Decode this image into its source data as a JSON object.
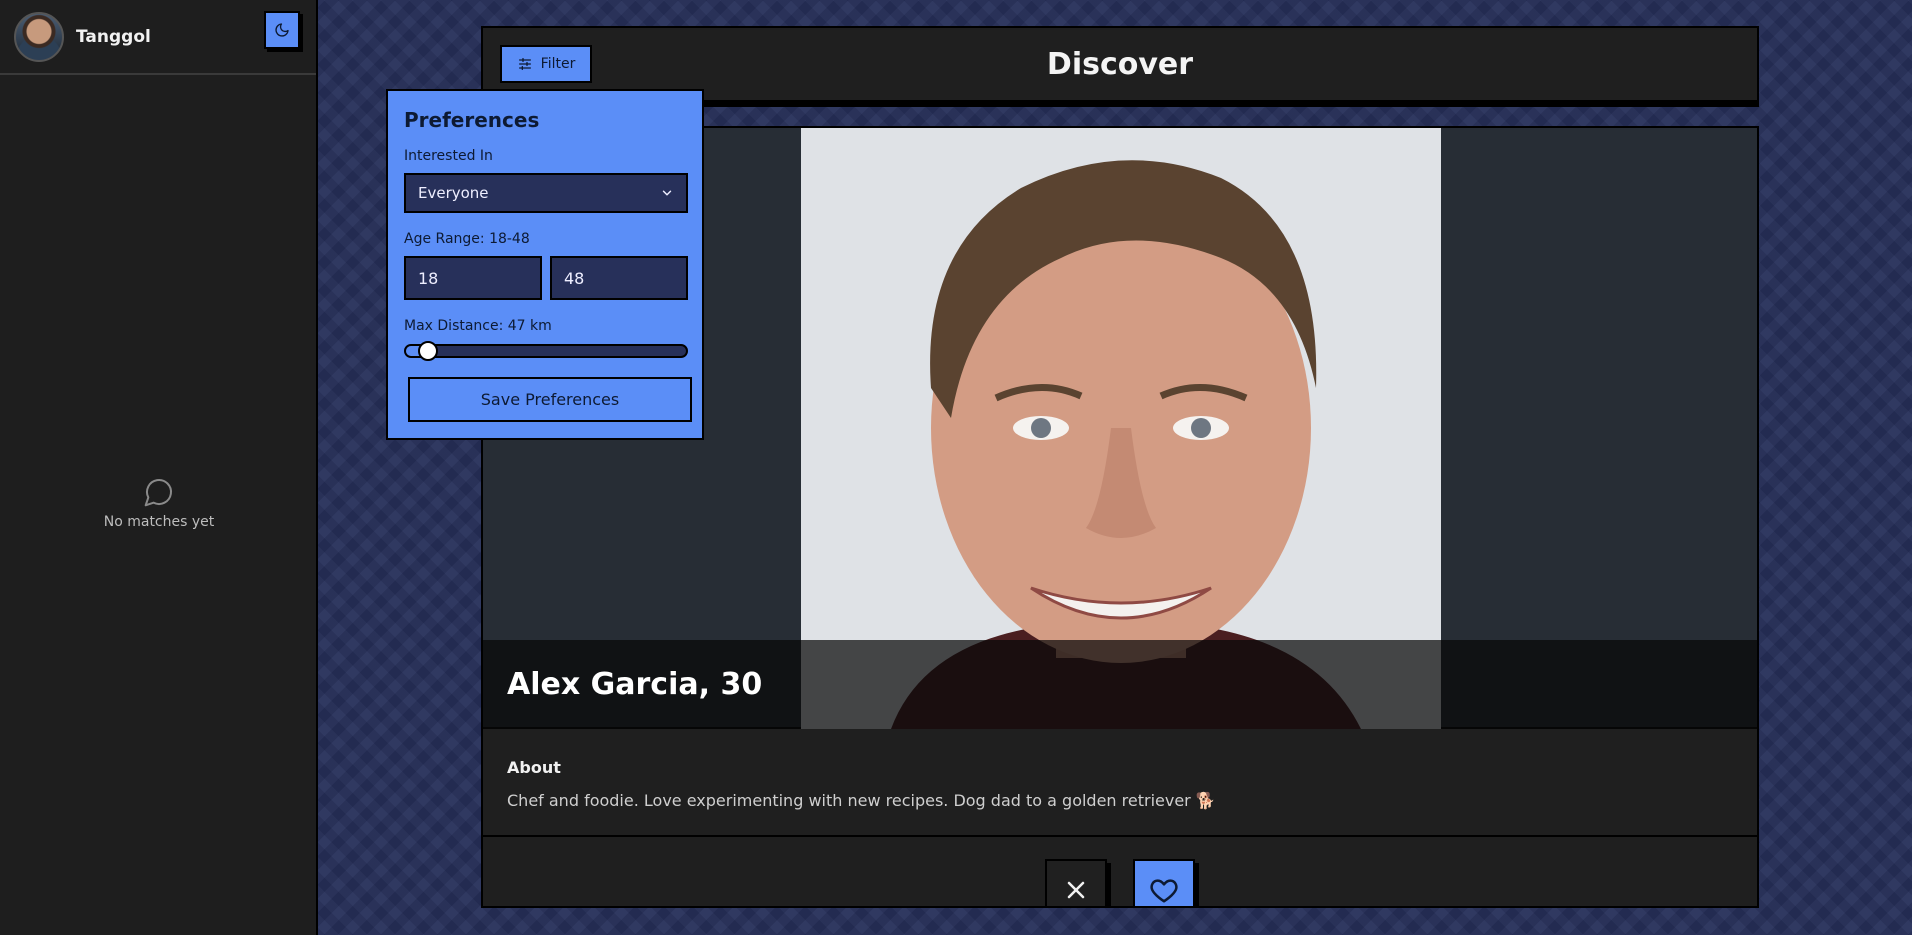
{
  "sidebar": {
    "username": "Tanggol",
    "empty_text": "No matches yet"
  },
  "header": {
    "title": "Discover",
    "filter_label": "Filter"
  },
  "preferences": {
    "title": "Preferences",
    "interested_label": "Interested In",
    "interested_value": "Everyone",
    "age_label": "Age Range: 18-48",
    "age_min": "18",
    "age_max": "48",
    "distance_label": "Max Distance: 47 km",
    "distance_fraction": 0.08,
    "save_label": "Save Preferences"
  },
  "profile": {
    "name": "Alex Garcia, 30",
    "about_heading": "About",
    "about_text": "Chef and foodie. Love experimenting with new recipes. Dog dad to a golden retriever 🐕"
  },
  "colors": {
    "accent": "#5b8ef7",
    "background": "#27305a",
    "panel": "#1f1f1f"
  }
}
